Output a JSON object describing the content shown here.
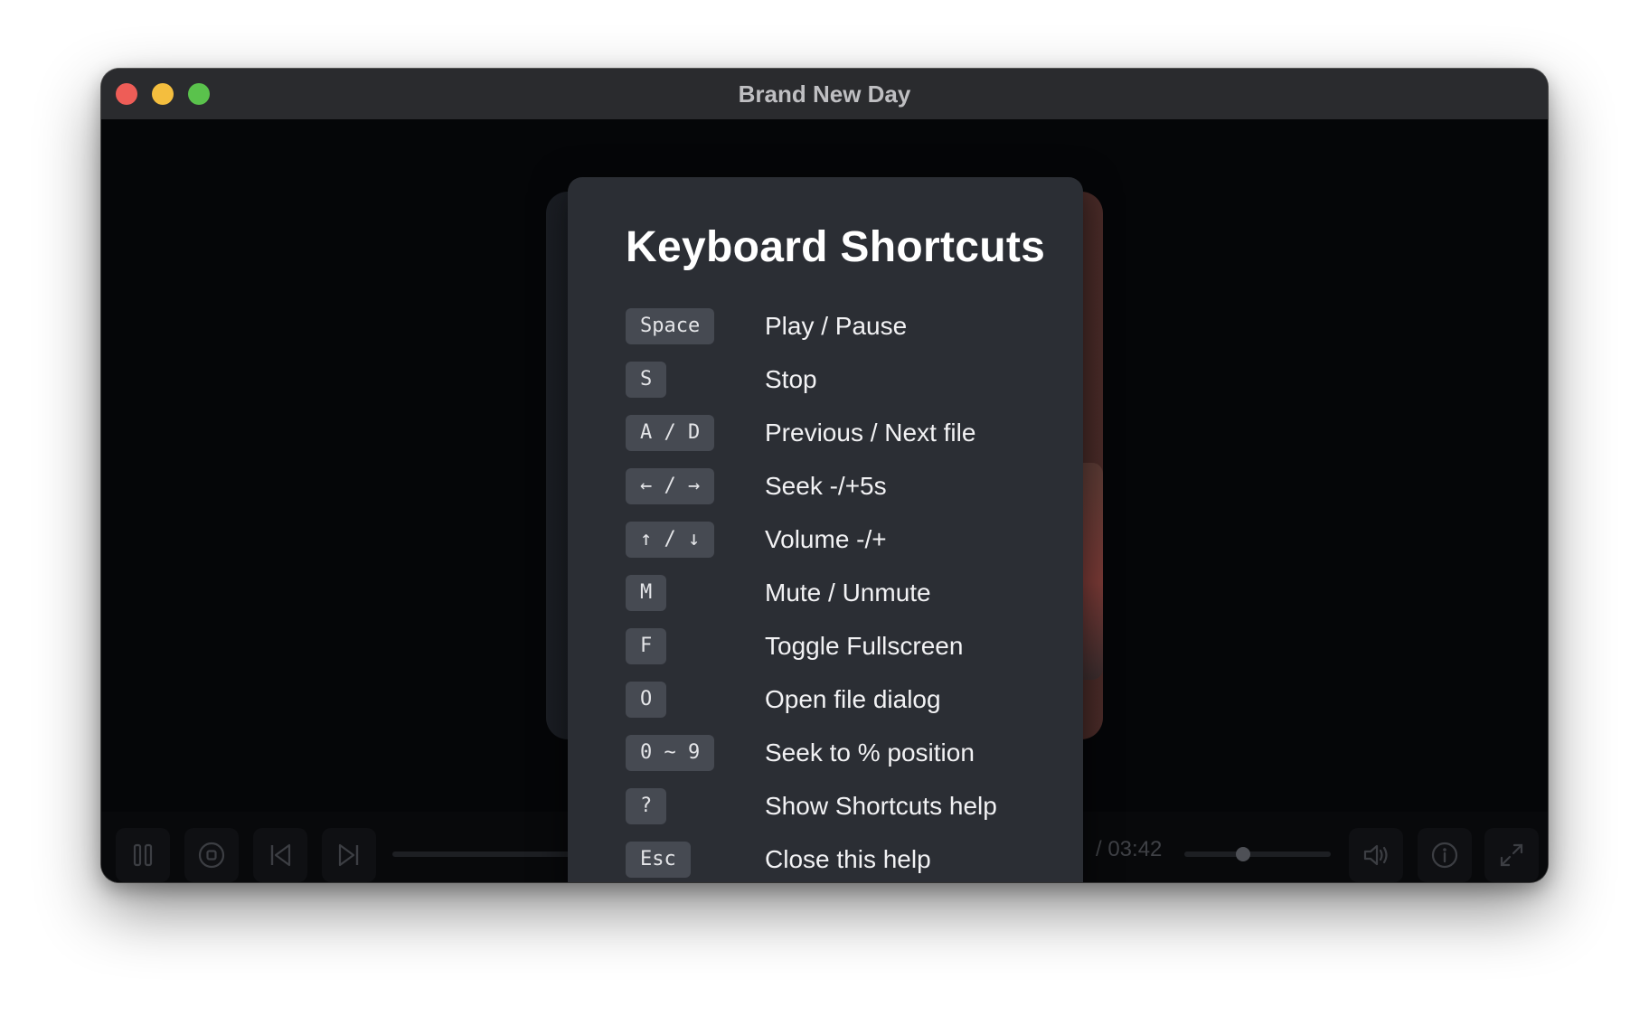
{
  "window": {
    "title": "Brand New Day"
  },
  "player": {
    "time_total": "/ 03:42",
    "volume_level": 0.4
  },
  "shortcuts": {
    "heading": "Keyboard Shortcuts",
    "items": [
      {
        "key": "Space",
        "action": "Play / Pause"
      },
      {
        "key": "S",
        "action": "Stop"
      },
      {
        "key": "A / D",
        "action": "Previous / Next file"
      },
      {
        "key": "← / →",
        "action": "Seek -/+5s"
      },
      {
        "key": "↑ / ↓",
        "action": "Volume -/+"
      },
      {
        "key": "M",
        "action": "Mute / Unmute"
      },
      {
        "key": "F",
        "action": "Toggle Fullscreen"
      },
      {
        "key": "O",
        "action": "Open file dialog"
      },
      {
        "key": "0 ~ 9",
        "action": "Seek to % position"
      },
      {
        "key": "?",
        "action": "Show Shortcuts help"
      },
      {
        "key": "Esc",
        "action": "Close this help"
      }
    ]
  },
  "icons": {
    "pause": "pause-icon",
    "stop": "stop-icon",
    "previous": "skip-previous-icon",
    "next": "skip-next-icon",
    "volume": "volume-icon",
    "info": "info-icon",
    "fullscreen": "fullscreen-icon"
  },
  "colors": {
    "close": "#ee5d57",
    "minimize": "#f4be3e",
    "maximize": "#5ac24c",
    "modal_bg": "#2b2e34",
    "key_bg": "#464a52"
  }
}
